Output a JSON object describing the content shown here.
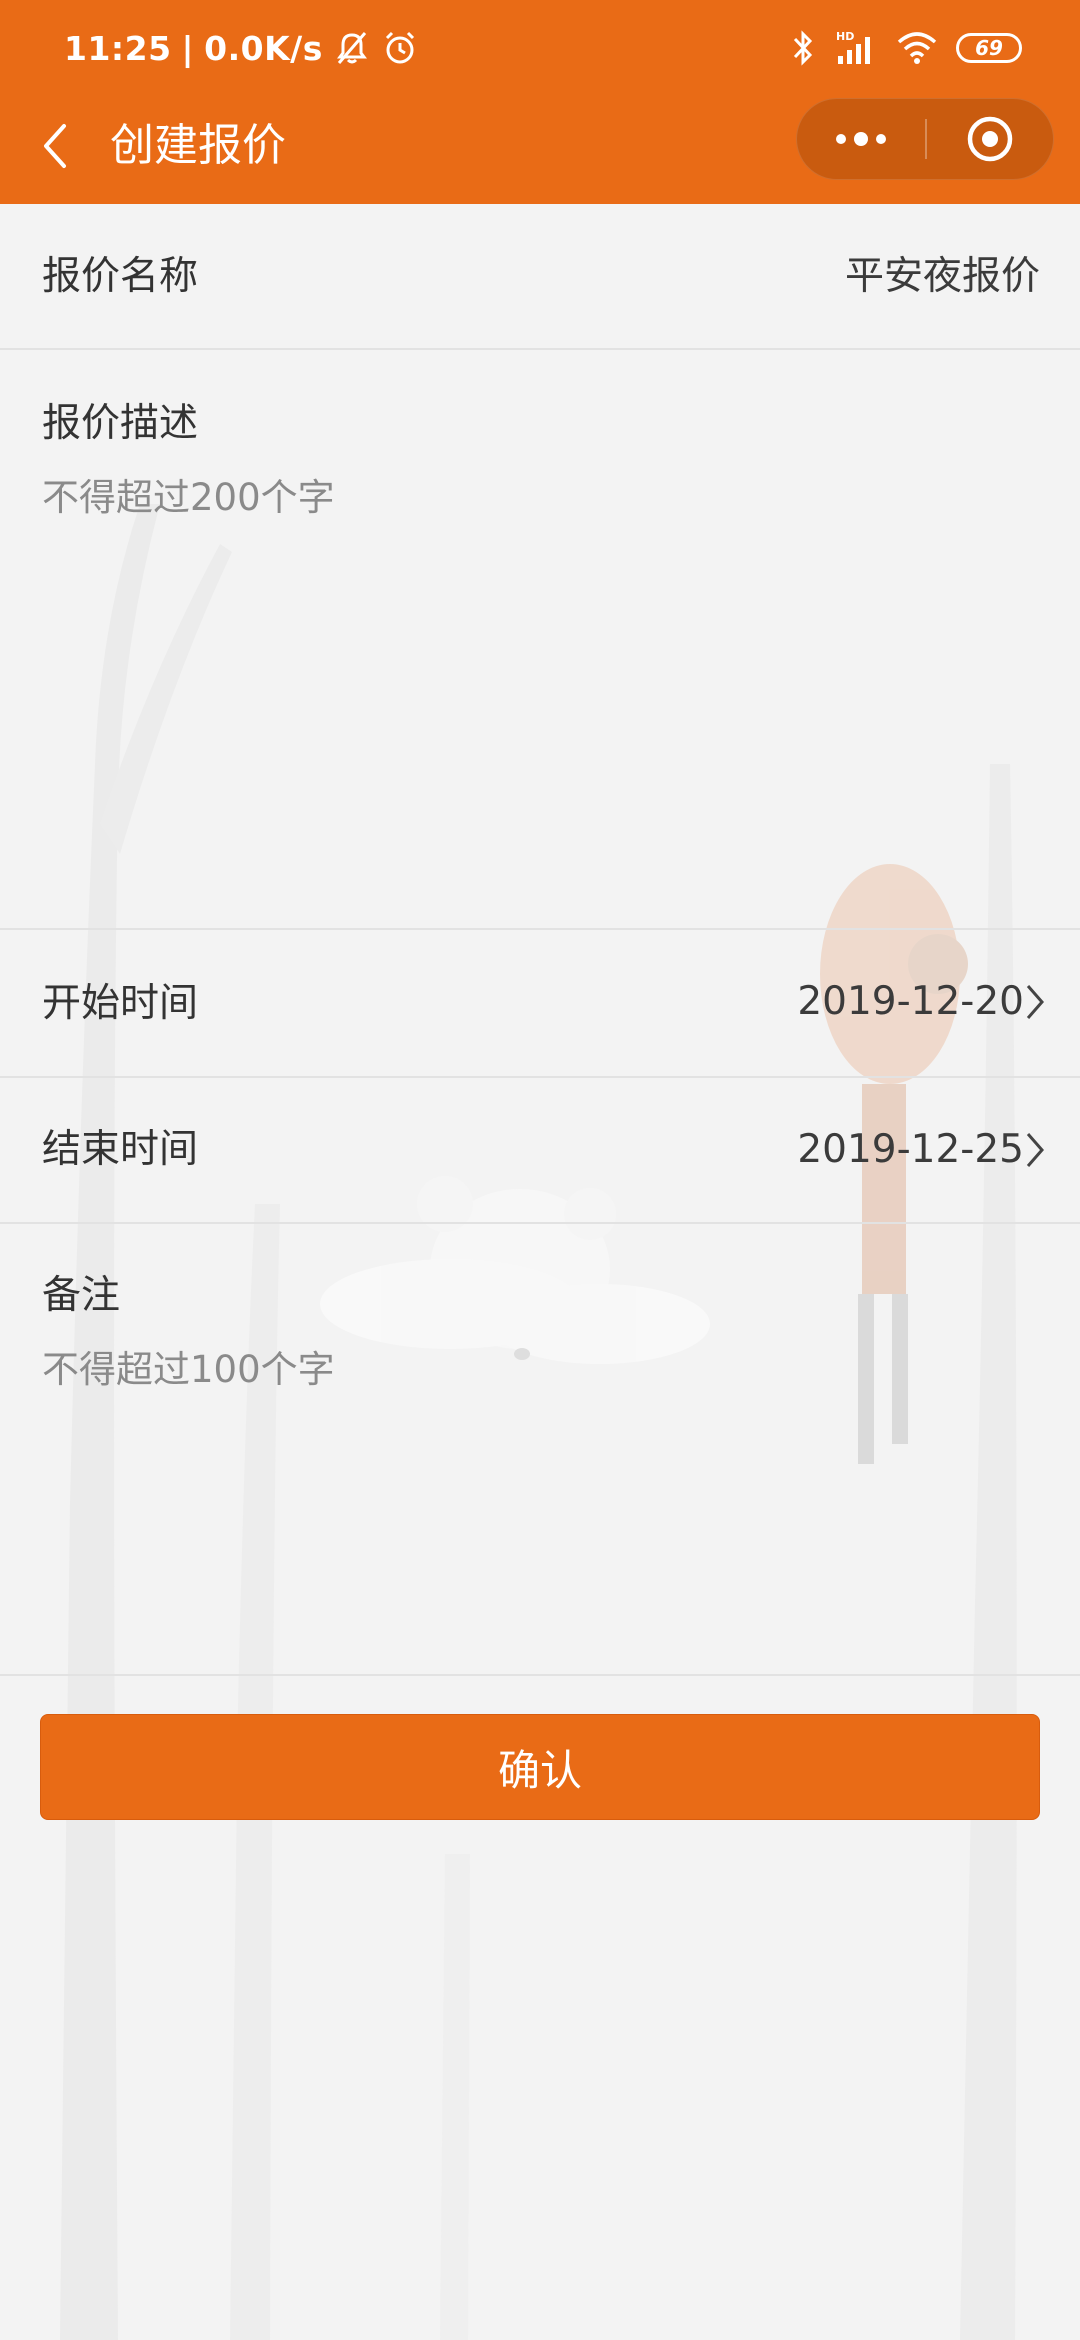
{
  "status_bar": {
    "time": "11:25",
    "separator": "|",
    "network_speed": "0.0K/s",
    "left_icons": [
      "bell-off-icon",
      "alarm-clock-icon"
    ],
    "right_icons": [
      "bluetooth-icon",
      "hd-signal-icon",
      "wifi-icon"
    ],
    "battery_level": "69"
  },
  "title_bar": {
    "back_icon": "chevron-left-icon",
    "title": "创建报价",
    "capsule_icons": [
      "more-dots-icon",
      "close-target-icon"
    ]
  },
  "form": {
    "quote_name": {
      "label": "报价名称",
      "value": "平安夜报价"
    },
    "quote_description": {
      "label": "报价描述",
      "placeholder": "不得超过200个字"
    },
    "start_time": {
      "label": "开始时间",
      "value": "2019-12-20"
    },
    "end_time": {
      "label": "结束时间",
      "value": "2019-12-25"
    },
    "remarks": {
      "label": "备注",
      "placeholder": "不得超过100个字"
    }
  },
  "confirm_label": "确认",
  "colors": {
    "brand_orange": "#e96b16",
    "background": "#f3f3f3",
    "divider": "#e2e2e2",
    "text": "#333333",
    "placeholder": "#8a8a8a"
  }
}
